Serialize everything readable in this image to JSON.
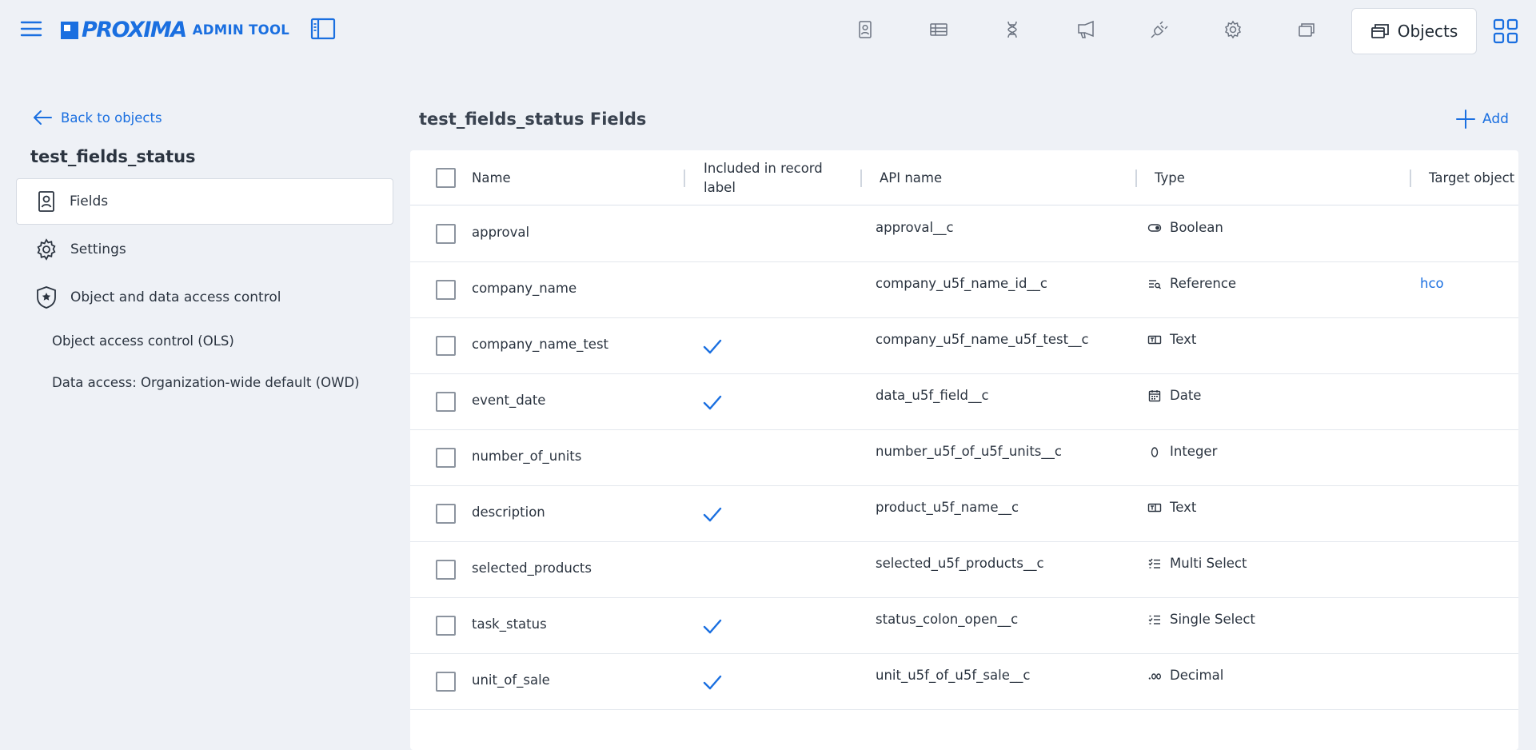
{
  "app": {
    "logo_text": "PROXIMA",
    "logo_subtitle": "ADMIN TOOL",
    "brand_color": "#1a6fe0"
  },
  "topnav": {
    "icons": [
      "contact-card-icon",
      "table-list-icon",
      "dna-icon",
      "megaphone-icon",
      "plug-icon",
      "gear-icon",
      "windows-icon"
    ],
    "objects_label": "Objects"
  },
  "sidebar": {
    "back_label": "Back to objects",
    "object_name": "test_fields_status",
    "items": [
      {
        "label": "Fields",
        "icon": "contact-card-icon",
        "active": true
      },
      {
        "label": "Settings",
        "icon": "gear-icon",
        "active": false
      },
      {
        "label": "Object and data access control",
        "icon": "shield-star-icon",
        "active": false
      }
    ],
    "subitems": [
      {
        "label": "Object access control (OLS)"
      },
      {
        "label": "Data access: Organization-wide default (OWD)"
      }
    ]
  },
  "main": {
    "title": "test_fields_status Fields",
    "add_label": "Add"
  },
  "table": {
    "headers": {
      "name": "Name",
      "included_line1": "Included in record",
      "included_line2": "label",
      "api": "API name",
      "type": "Type",
      "target": "Target object"
    },
    "rows": [
      {
        "name": "approval",
        "included": false,
        "api": "approval__c",
        "type": "Boolean",
        "type_icon": "toggle-icon",
        "target": ""
      },
      {
        "name": "company_name",
        "included": false,
        "api": "company_u5f_name_id__c",
        "type": "Reference",
        "type_icon": "reference-icon",
        "target": "hco"
      },
      {
        "name": "company_name_test",
        "included": true,
        "api": "company_u5f_name_u5f_test__c",
        "type": "Text",
        "type_icon": "text-field-icon",
        "target": ""
      },
      {
        "name": "event_date",
        "included": true,
        "api": "data_u5f_field__c",
        "type": "Date",
        "type_icon": "calendar-icon",
        "target": ""
      },
      {
        "name": "number_of_units",
        "included": false,
        "api": "number_u5f_of_u5f_units__c",
        "type": "Integer",
        "type_icon": "zero-icon",
        "target": ""
      },
      {
        "name": "description",
        "included": true,
        "api": "product_u5f_name__c",
        "type": "Text",
        "type_icon": "text-field-icon",
        "target": ""
      },
      {
        "name": "selected_products",
        "included": false,
        "api": "selected_u5f_products__c",
        "type": "Multi Select",
        "type_icon": "multi-check-list-icon",
        "target": ""
      },
      {
        "name": "task_status",
        "included": true,
        "api": "status_colon_open__c",
        "type": "Single Select",
        "type_icon": "single-check-list-icon",
        "target": ""
      },
      {
        "name": "unit_of_sale",
        "included": true,
        "api": "unit_u5f_of_u5f_sale__c",
        "type": "Decimal",
        "type_icon": "decimal-icon",
        "target": ""
      }
    ]
  }
}
